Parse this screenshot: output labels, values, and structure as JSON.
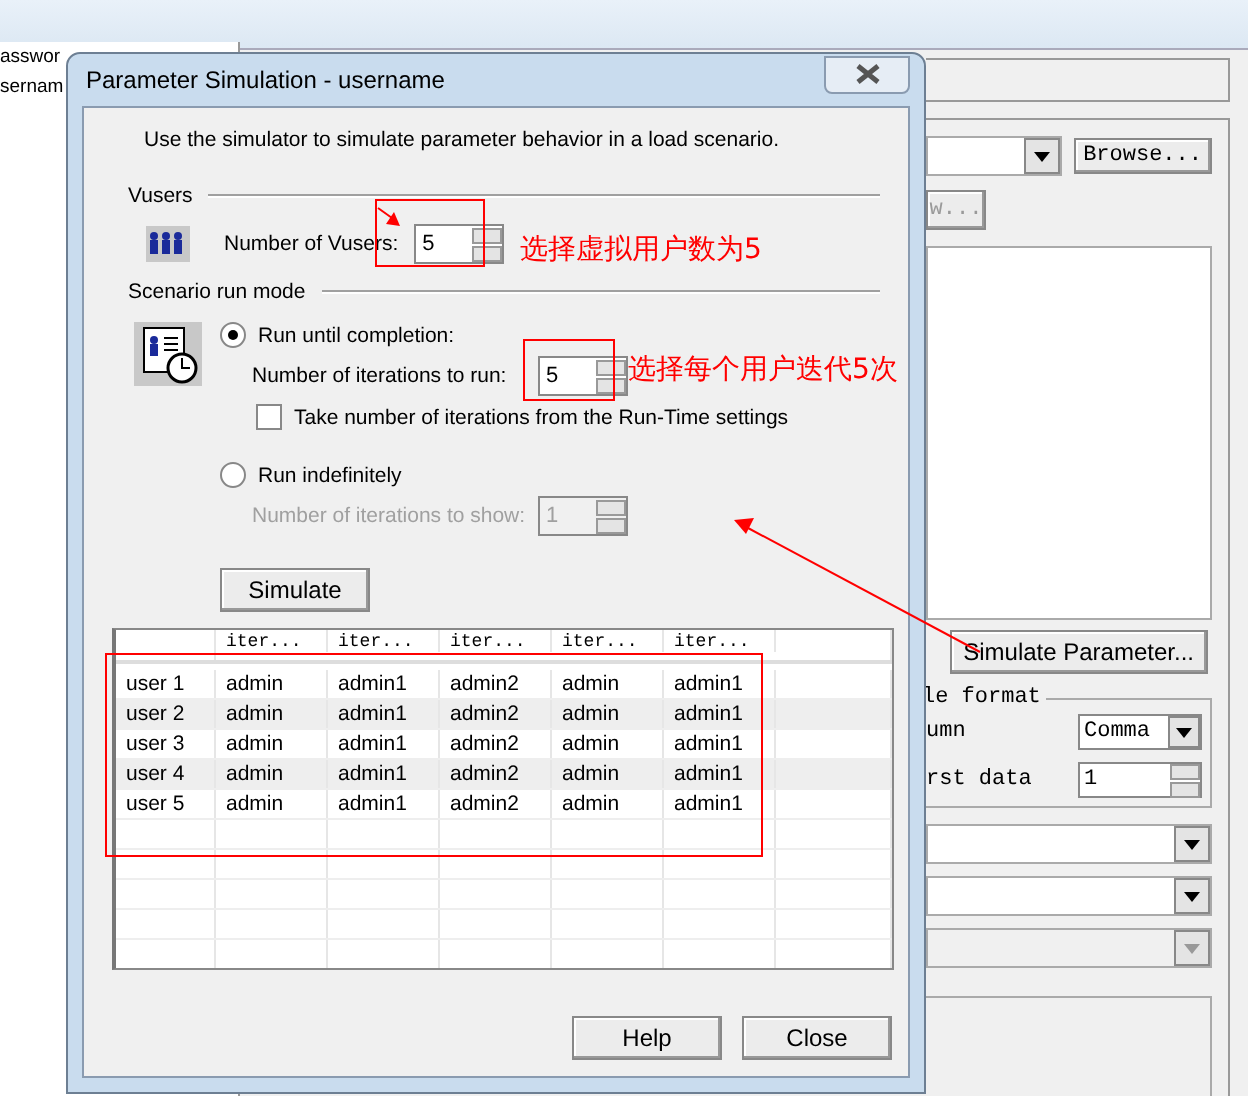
{
  "background_window": {
    "list_items": [
      "asswor",
      "sernam"
    ],
    "browse_button": "Browse...",
    "button_2": "w...",
    "simulate_parameter_button": "Simulate Parameter...",
    "file_format": {
      "title": "le format",
      "column_label": "umn",
      "column_value": "Comma",
      "first_data_label": "rst data",
      "first_data_value": "1"
    },
    "dropdowns": [
      {
        "disabled": false
      },
      {
        "disabled": false
      },
      {
        "disabled": true
      }
    ]
  },
  "dialog": {
    "title": "Parameter Simulation - username",
    "intro": "Use the simulator to simulate parameter behavior in a load scenario.",
    "vusers": {
      "heading": "Vusers",
      "label": "Number of Vusers:",
      "value": "5"
    },
    "run_mode": {
      "heading": "Scenario run mode",
      "options": [
        {
          "label": "Run until completion:",
          "selected": true,
          "field_label": "Number of iterations to run:",
          "field_value": "5",
          "disabled": false,
          "checkbox": {
            "label": "Take number of iterations from the Run-Time settings",
            "checked": false
          }
        },
        {
          "label": "Run indefinitely",
          "selected": false,
          "field_label": "Number of iterations to show:",
          "field_value": "1",
          "disabled": true
        }
      ]
    },
    "simulate_button": "Simulate",
    "table": {
      "columns": [
        "iter...",
        "iter...",
        "iter...",
        "iter...",
        "iter..."
      ],
      "rows": [
        {
          "label": "user 1",
          "cells": [
            "admin",
            "admin1",
            "admin2",
            "admin",
            "admin1"
          ]
        },
        {
          "label": "user 2",
          "cells": [
            "admin",
            "admin1",
            "admin2",
            "admin",
            "admin1"
          ]
        },
        {
          "label": "user 3",
          "cells": [
            "admin",
            "admin1",
            "admin2",
            "admin",
            "admin1"
          ]
        },
        {
          "label": "user 4",
          "cells": [
            "admin",
            "admin1",
            "admin2",
            "admin",
            "admin1"
          ]
        },
        {
          "label": "user 5",
          "cells": [
            "admin",
            "admin1",
            "admin2",
            "admin",
            "admin1"
          ]
        }
      ]
    },
    "buttons": [
      "Help",
      "Close"
    ]
  },
  "annotations": [
    {
      "text": "选择虚拟用户数为5"
    },
    {
      "text": "选择每个用户迭代5次"
    }
  ]
}
